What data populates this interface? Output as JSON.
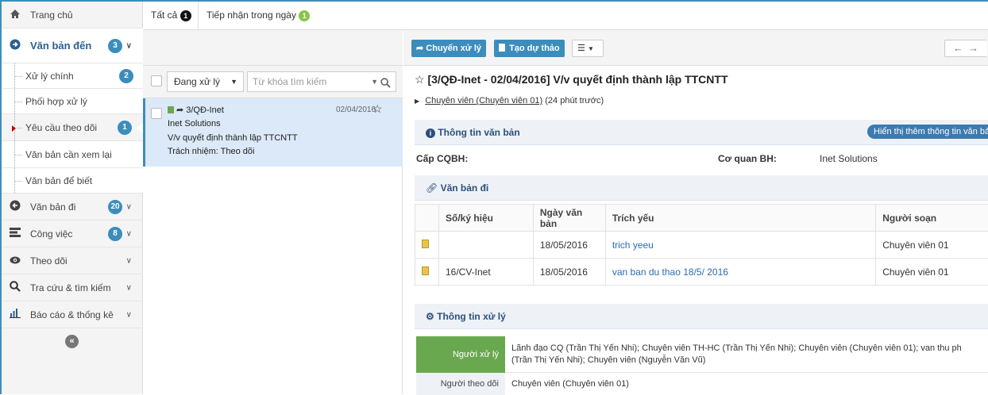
{
  "sidebar": {
    "home": "Trang chủ",
    "incoming": {
      "label": "Văn bản đến",
      "badge": "3"
    },
    "sub": [
      {
        "label": "Xử lý chính",
        "badge": "2"
      },
      {
        "label": "Phối hợp xử lý",
        "badge": ""
      },
      {
        "label": "Yêu cầu theo dõi",
        "badge": "1"
      },
      {
        "label": "Văn bản cần xem lại",
        "badge": ""
      },
      {
        "label": "Văn bản để biết",
        "badge": ""
      }
    ],
    "outgoing": {
      "label": "Văn bản đi",
      "badge": "20"
    },
    "tasks": {
      "label": "Công việc",
      "badge": "8"
    },
    "follow": {
      "label": "Theo dõi"
    },
    "search": {
      "label": "Tra cứu & tìm kiếm"
    },
    "reports": {
      "label": "Báo cáo & thống kê"
    },
    "collapse_glyph": "«"
  },
  "tabs": [
    {
      "label": "Tất cả",
      "badge": "1"
    },
    {
      "label": "Tiếp nhận trong ngày",
      "badge": "1"
    }
  ],
  "list": {
    "filter_value": "Đang xử lý",
    "search_placeholder": "Từ khóa tìm kiếm",
    "item": {
      "number": "3/QĐ-Inet",
      "date": "02/04/2016",
      "org": "Inet Solutions",
      "subject": "V/v quyết định thành lập TTCNTT",
      "responsibility": "Trách nhiệm: Theo dõi"
    }
  },
  "toolbar": {
    "forward": "Chuyển xử lý",
    "draft": "Tạo dự thảo"
  },
  "doc": {
    "title": "[3/QĐ-Inet - 02/04/2016] V/v quyết định thành lập TTCNTT",
    "sender_link": "Chuyên viên (Chuyên viên 01)",
    "sender_time": "(24 phút trước)",
    "info_header": "Thông tin văn bản",
    "show_more": "Hiển thị thêm thông tin văn bả",
    "cqbh_label": "Cấp CQBH:",
    "agency_label": "Cơ quan BH:",
    "agency_value": "Inet Solutions",
    "outgoing_header": "Văn bản đi",
    "table_headers": [
      "Số/ký hiệu",
      "Ngày văn bản",
      "Trích yếu",
      "Người soạn"
    ],
    "table_rows": [
      {
        "number": "",
        "date": "18/05/2016",
        "summary": "trich yeeu",
        "author": "Chuyên viên 01"
      },
      {
        "number": "16/CV-Inet",
        "date": "18/05/2016",
        "summary": "van ban du thao 18/5/ 2016",
        "author": "Chuyên viên 01"
      }
    ],
    "process_header": "Thông tin xử lý",
    "handler_label": "Người xử lý",
    "handler_value_1": "Lãnh đạo CQ (Trần Thị Yến Nhi); Chuyên viên TH-HC (Trần Thị Yến Nhi); Chuyên viên (Chuyên viên 01); van thu ph",
    "handler_value_2": "(Trần Thị Yến Nhi); Chuyên viên (Nguyễn Văn Vũ)",
    "follower_label": "Người theo dõi",
    "follower_value": "Chuyên viên (Chuyên viên 01)"
  }
}
